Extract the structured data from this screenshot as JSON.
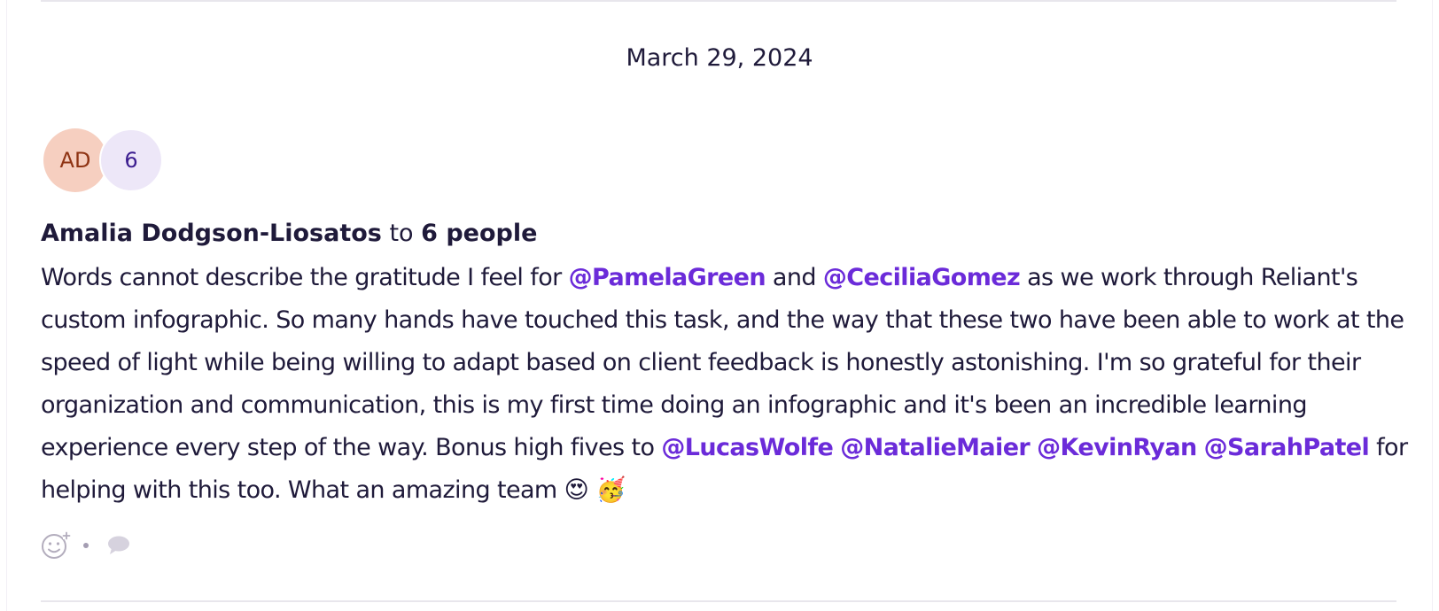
{
  "feed": {
    "date": "March 29, 2024"
  },
  "post": {
    "avatar_initials": "AD",
    "recipient_count_badge": "6",
    "sender": "Amalia Dodgson-Liosatos",
    "to_word": "to",
    "recipients_label": "6 people",
    "message": {
      "part1": "Words cannot describe the gratitude I feel for ",
      "mention1": "@PamelaGreen",
      "part2": " and ",
      "mention2": "@CeciliaGomez",
      "part3": "  as we work through Reliant's custom infographic. So many hands have touched this task, and the way that these two have been able to work at the speed of light while being willing to adapt based on client feedback is honestly astonishing. I'm so grateful for their organization and communication, this is my first time doing an infographic and it's been an incredible learning experience every step of the way. Bonus high fives to ",
      "mention3": "@LucasWolfe",
      "space1": " ",
      "mention4": "@NatalieMaier",
      "space2": " ",
      "mention5": "@KevinRyan",
      "space3": " ",
      "mention6": "@SarahPatel",
      "part4": " for helping with this too. What an amazing team ",
      "emoji1": "😍",
      "emoji_space": " ",
      "emoji2": "🥳"
    },
    "actions": {
      "react_icon": "add-reaction-icon",
      "comment_icon": "comment-icon"
    }
  },
  "colors": {
    "text": "#1f1a3a",
    "mention": "#6b2bd9",
    "avatar_initials_bg": "#f6cfc0",
    "avatar_initials_text": "#8f3414",
    "avatar_count_bg": "#ede7f8",
    "avatar_count_text": "#3b1d8f",
    "divider": "#e8e6ec"
  }
}
